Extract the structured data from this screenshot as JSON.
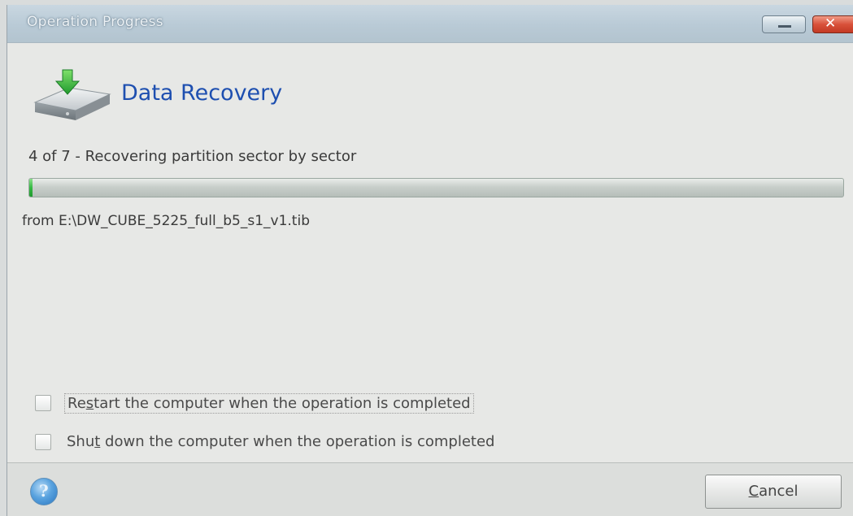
{
  "window": {
    "title": "Operation Progress",
    "minimize_icon": "minimize-icon",
    "close_icon": "close-icon"
  },
  "header": {
    "icon": "drive-download-icon",
    "title": "Data Recovery"
  },
  "progress": {
    "step_text": "4 of 7 - Recovering partition sector by sector",
    "fraction": 0.004,
    "fill_color": "#35b843",
    "source_text": "from E:\\DW_CUBE_5225_full_b5_s1_v1.tib"
  },
  "options": {
    "restart": {
      "label_pre": "Re",
      "label_key": "s",
      "label_post": "tart the computer when the operation is completed",
      "checked": false
    },
    "shutdown": {
      "label_pre": "Shu",
      "label_key": "t",
      "label_post": " down the computer when the operation is completed",
      "checked": false
    }
  },
  "footer": {
    "help_icon": "help-icon",
    "cancel_key": "C",
    "cancel_rest": "ancel"
  },
  "colors": {
    "title_accent": "#1e4fb0"
  }
}
